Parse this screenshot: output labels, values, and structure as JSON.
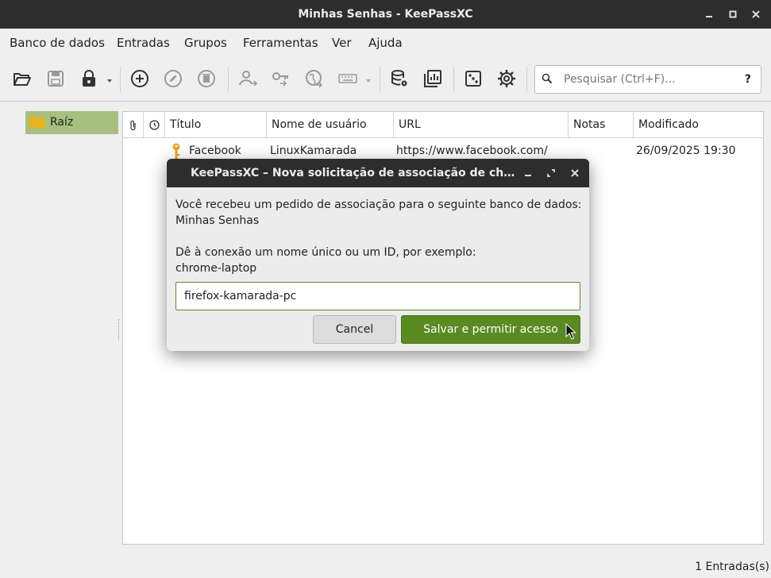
{
  "window": {
    "title": "Minhas Senhas - KeePassXC"
  },
  "menubar": {
    "items": [
      "Banco de dados",
      "Entradas",
      "Grupos",
      "Ferramentas",
      "Ver",
      "Ajuda"
    ]
  },
  "toolbar": {
    "icons": [
      "open-database-icon",
      "save-database-icon",
      "lock-database-icon",
      "add-entry-icon",
      "edit-entry-icon",
      "delete-entry-icon",
      "copy-username-icon",
      "copy-password-icon",
      "copy-url-icon",
      "autotype-keyboard-icon",
      "database-settings-icon",
      "reports-icon",
      "password-generator-icon",
      "settings-gear-icon"
    ]
  },
  "search": {
    "placeholder": "Pesquisar (Ctrl+F)...",
    "help": "?"
  },
  "groups": {
    "items": [
      {
        "label": "Raíz",
        "selected": true
      }
    ]
  },
  "entries": {
    "headers": {
      "title": "Título",
      "username": "Nome de usuário",
      "url": "URL",
      "notes": "Notas",
      "modified": "Modificado"
    },
    "rows": [
      {
        "title": "Facebook",
        "username": "LinuxKamarada",
        "url": "https://www.facebook.com/",
        "notes": "",
        "modified": "26/09/2025 19:30"
      }
    ]
  },
  "status": {
    "count": "1 Entradas(s)"
  },
  "dialog": {
    "title": "KeePassXC – Nova solicitação de associação de ch...",
    "line1": "Você recebeu um pedido de associação para o seguinte banco de dados:",
    "line2": "Minhas Senhas",
    "line3": "Dê à conexão um nome único ou um ID, por exemplo:",
    "line4": "chrome-laptop",
    "input_value": "firefox-kamarada-pc",
    "cancel_label": "Cancel",
    "save_label": "Salvar e permitir acesso"
  },
  "colors": {
    "titlebar": "#2d2d2d",
    "selected_group": "#a7c080",
    "primary_button": "#5a8a22",
    "key_icon": "#e8a61c",
    "folder_icon": "#e6b422"
  }
}
